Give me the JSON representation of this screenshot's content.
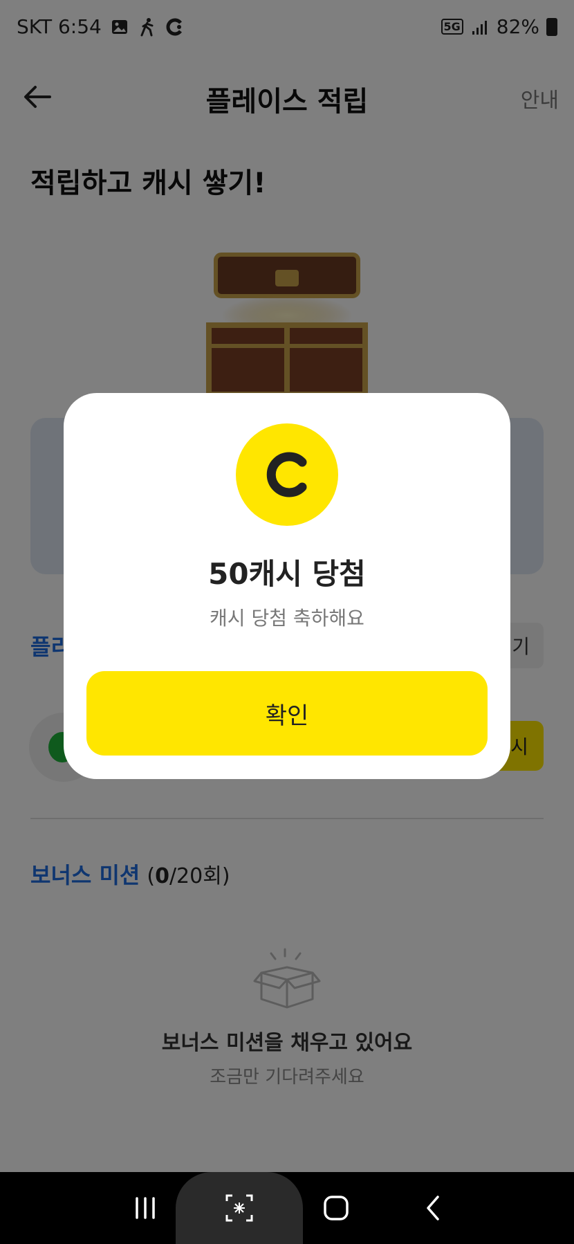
{
  "status_bar": {
    "carrier_time": "SKT 6:54",
    "network": "5G",
    "battery": "82%"
  },
  "appbar": {
    "title": "플레이스 적립",
    "guide_label": "안내"
  },
  "hero": {
    "title": "적립하고 캐시 쌓기!"
  },
  "background": {
    "place_label_partial": "플리",
    "small_button_partial": "기",
    "yellow_button_partial": "시"
  },
  "bonus": {
    "title": "보너스 미션",
    "count_open": "(",
    "count_current": "0",
    "count_rest": "/20회)"
  },
  "empty_state": {
    "title": "보너스 미션을 채우고 있어요",
    "subtitle": "조금만 기다려주세요"
  },
  "modal": {
    "coin_letter": "C",
    "title": "50캐시 당첨",
    "subtitle": "캐시 당첨 축하해요",
    "confirm_label": "확인"
  },
  "colors": {
    "accent_yellow": "#ffe600",
    "accent_blue": "#1f6ce0",
    "green": "#1fb43a"
  }
}
